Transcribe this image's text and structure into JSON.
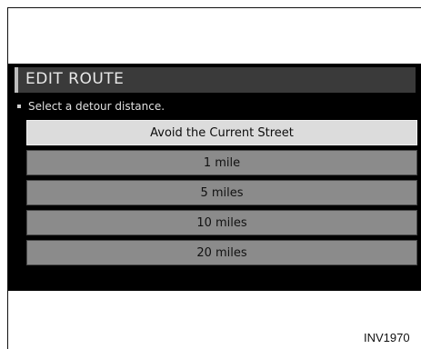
{
  "screen": {
    "title": "EDIT ROUTE",
    "instruction": "Select a detour distance.",
    "options": [
      {
        "label": "Avoid the Current Street",
        "selected": true
      },
      {
        "label": "1 mile",
        "selected": false
      },
      {
        "label": "5 miles",
        "selected": false
      },
      {
        "label": "10 miles",
        "selected": false
      },
      {
        "label": "20 miles",
        "selected": false
      }
    ]
  },
  "footer": {
    "code": "INV1970"
  }
}
